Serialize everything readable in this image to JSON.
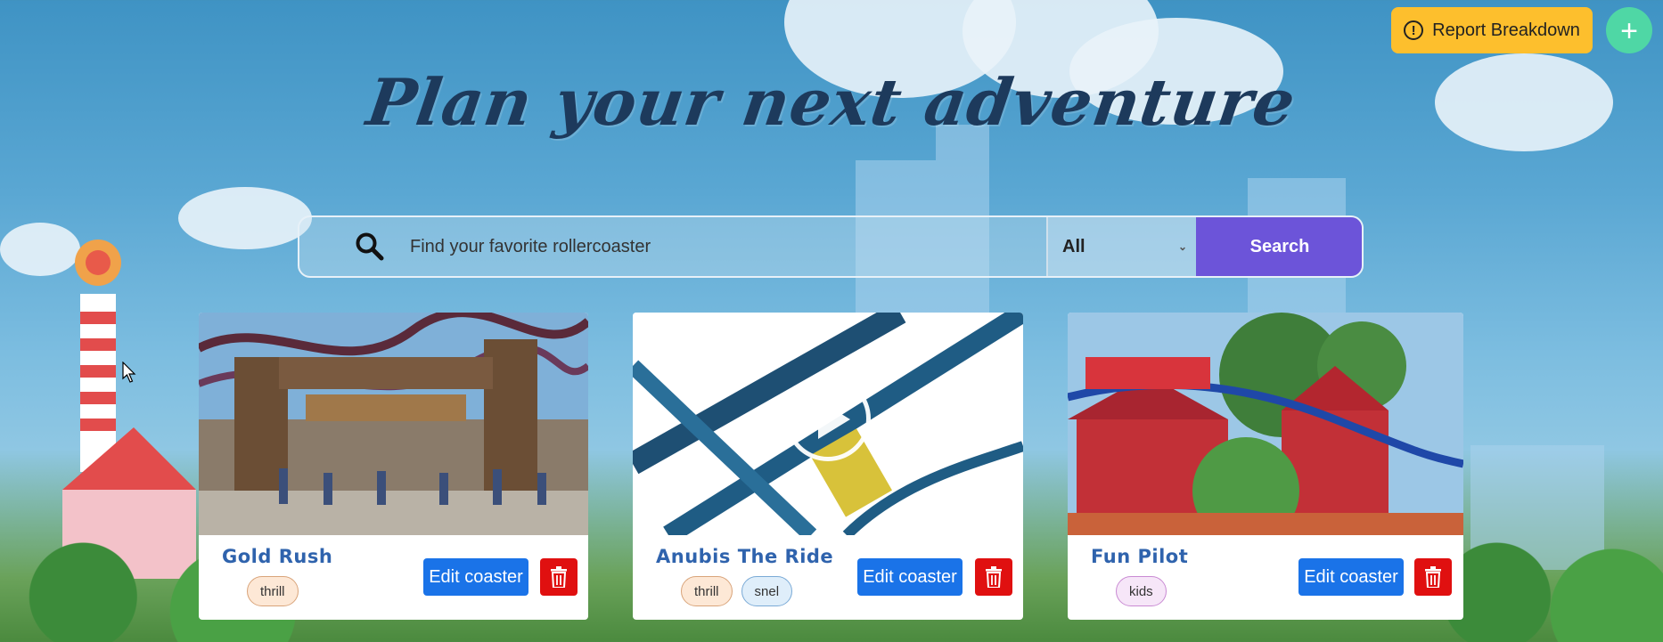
{
  "header": {
    "report_label": "Report Breakdown",
    "report_icon": "warning-circle-icon",
    "add_icon": "plus-icon",
    "add_symbol": "+"
  },
  "hero": {
    "title": "Plan your next adventure"
  },
  "search": {
    "placeholder": "Find your favorite rollercoaster",
    "value": "",
    "filter_selected": "All",
    "button_label": "Search"
  },
  "cards": [
    {
      "name": "Gold Rush",
      "tags": [
        "thrill"
      ],
      "edit_label": "Edit coaster",
      "has_video": false
    },
    {
      "name": "Anubis The Ride",
      "tags": [
        "thrill",
        "snel"
      ],
      "edit_label": "Edit coaster",
      "has_video": true
    },
    {
      "name": "Fun Pilot",
      "tags": [
        "kids"
      ],
      "edit_label": "Edit coaster",
      "has_video": false
    }
  ],
  "colors": {
    "report_button": "#fdbf2d",
    "add_button": "#4fd7a5",
    "search_button": "#6c54d9",
    "edit_button": "#1a73e8",
    "delete_button": "#e01010",
    "card_title": "#2f63ad",
    "hero_title": "#1d3a5c"
  }
}
